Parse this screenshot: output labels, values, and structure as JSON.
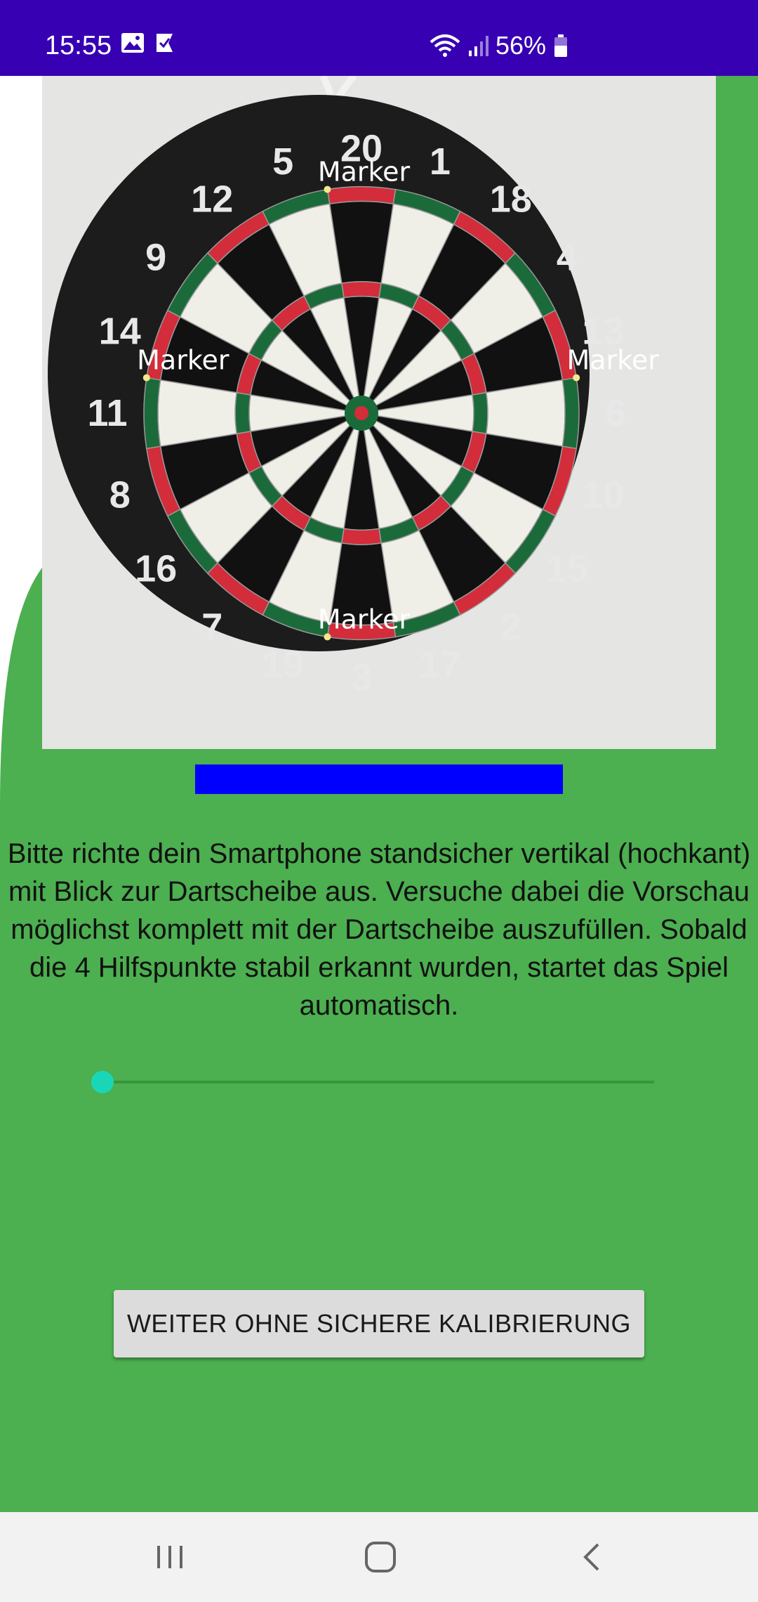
{
  "status_bar": {
    "time": "15:55",
    "battery": "56%",
    "icons": [
      "gallery-icon",
      "check-notification-icon",
      "wifi-icon",
      "signal-icon",
      "battery-icon"
    ]
  },
  "preview": {
    "marker_labels": [
      "Marker",
      "Marker",
      "Marker",
      "Marker"
    ],
    "board_numbers": [
      "20",
      "1",
      "18",
      "4",
      "13",
      "6",
      "10",
      "15",
      "2",
      "17",
      "3",
      "19",
      "7",
      "16",
      "8",
      "11",
      "14",
      "9",
      "12",
      "5"
    ]
  },
  "instruction_text": "Bitte richte dein Smartphone standsicher vertikal (hochkant) mit Blick zur Dartscheibe aus. Versuche dabei die Vorschau möglichst komplett mit der Dartscheibe auszufüllen. Sobald die 4 Hilfspunkte stabil erkannt wurden, startet das Spiel automatisch.",
  "calibration_progress": 0,
  "skip_button_label": "WEITER OHNE SICHERE KALIBRIERUNG",
  "colors": {
    "status_bar": "#3700b3",
    "background_green": "#4caf50",
    "progress_bar": "#0000ff",
    "slider_thumb": "#1ad6b8"
  },
  "nav": [
    "recent-apps-icon",
    "home-icon",
    "back-icon"
  ]
}
